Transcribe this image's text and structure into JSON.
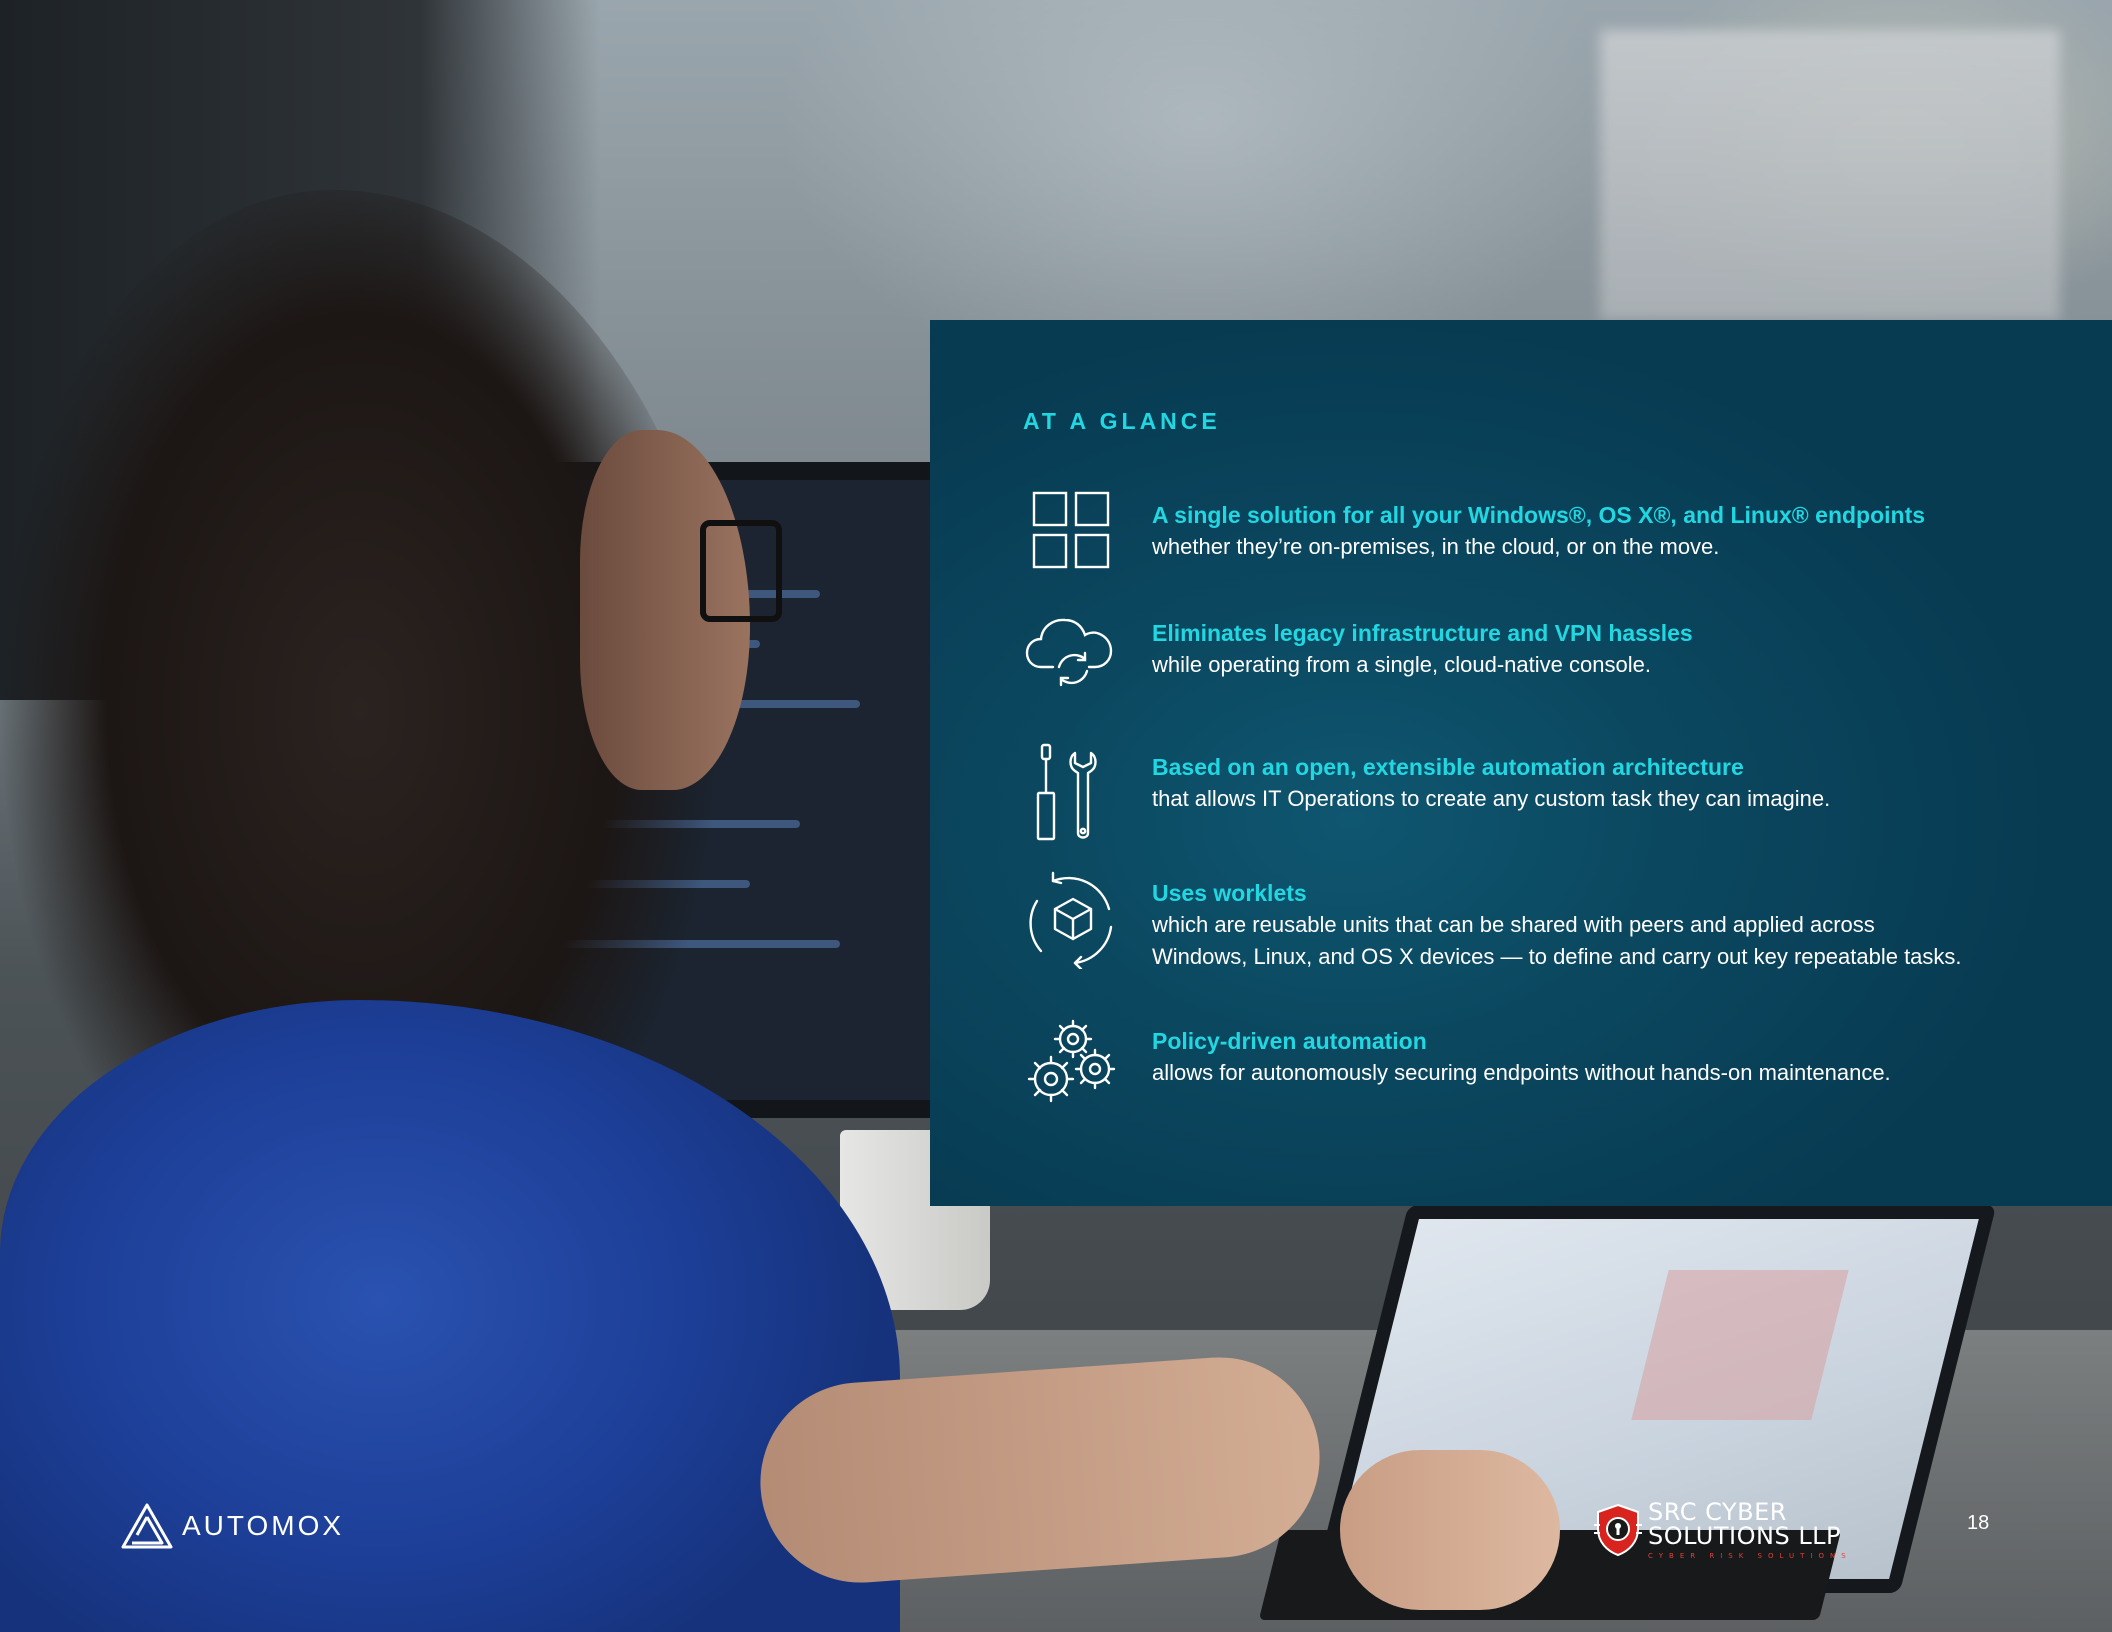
{
  "panel": {
    "title": "AT A GLANCE",
    "background_color": "#0b4860",
    "accent_color": "#20d7e2",
    "items": [
      {
        "icon": "windows-grid-icon",
        "heading": "A single solution for all your Windows®, OS X®, and Linux® endpoints",
        "body": "whether they’re on-premises, in the cloud, or on the move."
      },
      {
        "icon": "cloud-sync-icon",
        "heading": "Eliminates legacy infrastructure and VPN hassles",
        "body": "while operating from a single, cloud-native console."
      },
      {
        "icon": "tools-icon",
        "heading": "Based on an open, extensible automation architecture",
        "body": "that allows IT Operations to create any custom task they can imagine."
      },
      {
        "icon": "worklet-cube-cycle-icon",
        "heading": "Uses worklets",
        "body_lines": [
          "which are reusable units that can be shared with peers and applied across",
          "Windows, Linux, and OS X devices — to define and carry out key repeatable tasks."
        ]
      },
      {
        "icon": "gears-icon",
        "heading": "Policy-driven automation",
        "body": "allows for autonomously securing endpoints without hands-on maintenance."
      }
    ]
  },
  "footer": {
    "brand": "AUTOMOX",
    "brand_icon": "automox-logo-icon",
    "partner_line1": "SRC CYBER",
    "partner_line2": "SOLUTIONS LLP",
    "partner_tagline": "CYBER RISK SOLUTIONS",
    "partner_icon": "shield-lock-icon",
    "page_number": "18"
  }
}
